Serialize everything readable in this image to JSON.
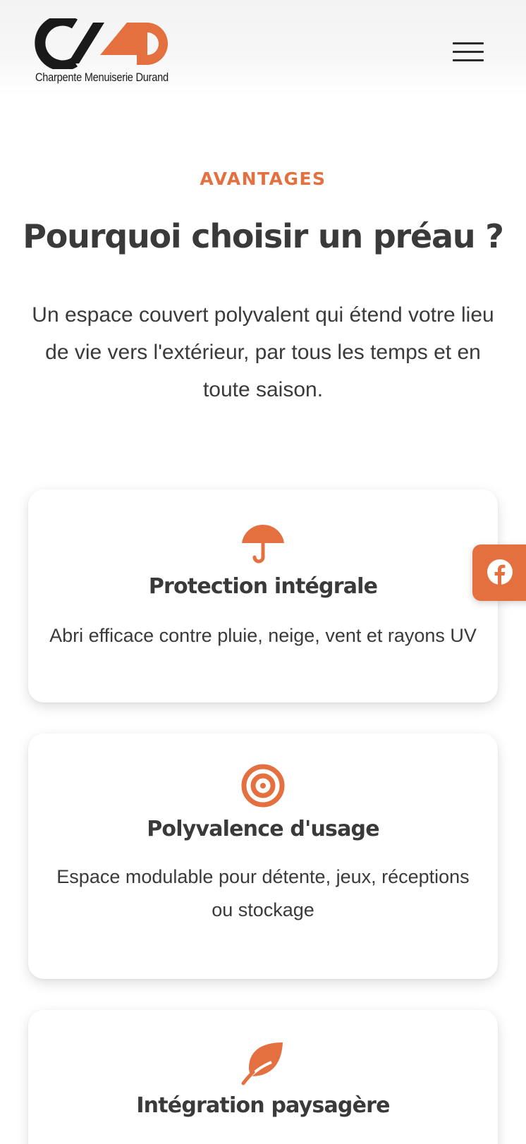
{
  "brand": {
    "tagline": "Charpente Menuiserie Durand",
    "accent_color": "#e4703f",
    "dark_color": "#1a1a1a"
  },
  "header": {
    "menu_icon": "hamburger-icon"
  },
  "intro": {
    "eyebrow": "AVANTAGES",
    "title": "Pourquoi choisir un préau ?",
    "description": "Un espace couvert polyvalent qui étend votre lieu de vie vers l'extérieur, par tous les temps et en toute saison."
  },
  "features": [
    {
      "icon": "umbrella-icon",
      "title": "Protection intégrale",
      "text": "Abri efficace contre pluie, neige, vent et rayons UV"
    },
    {
      "icon": "target-icon",
      "title": "Polyvalence d'usage",
      "text": "Espace modulable pour détente, jeux, réceptions ou stockage"
    },
    {
      "icon": "leaf-icon",
      "title": "Intégration paysagère",
      "text": ""
    }
  ],
  "social": {
    "facebook_icon": "facebook-icon"
  }
}
